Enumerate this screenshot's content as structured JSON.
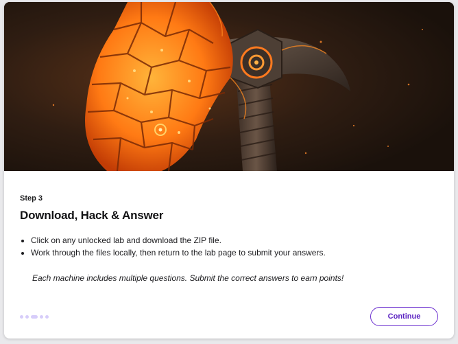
{
  "colors": {
    "accent": "#6b2fcf",
    "dot_inactive": "#d7cdfa",
    "text_primary": "#121214",
    "lava": "#ff8a1f",
    "rock": "#2a1b12"
  },
  "hero": {
    "image_description_icon": "lava-axe-illustration"
  },
  "step": {
    "label": "Step 3",
    "title": "Download, Hack & Answer",
    "bullets": [
      "Click on any unlocked lab and download the ZIP file.",
      "Work through the files locally, then return to the lab page to submit your answers."
    ],
    "note": "Each machine includes multiple questions. Submit the correct answers to earn points!"
  },
  "pagination": {
    "total": 5,
    "current": 3
  },
  "actions": {
    "continue_label": "Continue"
  }
}
